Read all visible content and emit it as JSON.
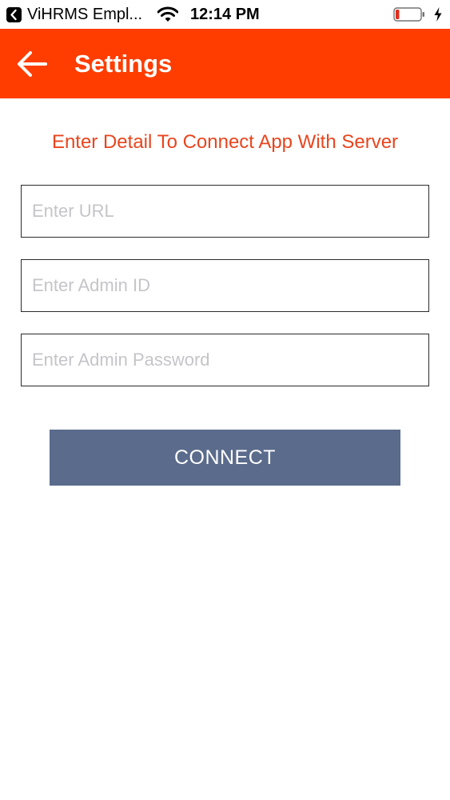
{
  "status_bar": {
    "back_app_label": "ViHRMS Empl...",
    "time": "12:14 PM",
    "battery_level": 0.15,
    "battery_color": "#e0301e",
    "charging": true,
    "icons": [
      "back-to-app-icon",
      "wifi-icon",
      "battery-icon",
      "charging-bolt-icon"
    ]
  },
  "header": {
    "title": "Settings",
    "background_color": "#ff3d00",
    "back_icon": "arrow-left-icon"
  },
  "form": {
    "instruction": "Enter Detail To Connect App With Server",
    "instruction_color": "#e8451e",
    "url_placeholder": "Enter URL",
    "url_value": "",
    "admin_id_placeholder": "Enter Admin ID",
    "admin_id_value": "",
    "admin_password_placeholder": "Enter Admin Password",
    "admin_password_value": "",
    "connect_label": "CONNECT",
    "connect_color": "#5a6b8c"
  }
}
